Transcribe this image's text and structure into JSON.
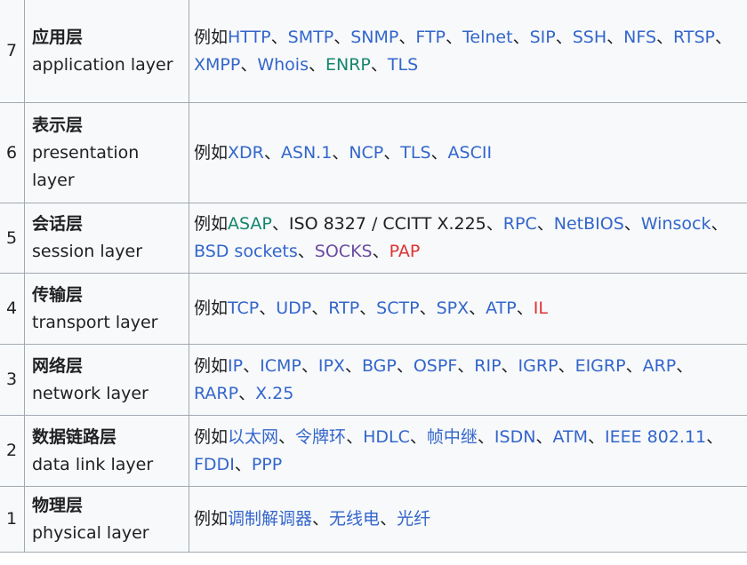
{
  "prefix": "例如",
  "rows": [
    {
      "num": "7",
      "name_zh": "应用层",
      "name_en": "application layer",
      "height": 116,
      "protocols": [
        {
          "text": "HTTP",
          "style": "link"
        },
        {
          "text": "SMTP",
          "style": "link"
        },
        {
          "text": "SNMP",
          "style": "link"
        },
        {
          "text": "FTP",
          "style": "link"
        },
        {
          "text": "Telnet",
          "style": "link"
        },
        {
          "text": "SIP",
          "style": "link"
        },
        {
          "text": "SSH",
          "style": "link"
        },
        {
          "text": "NFS",
          "style": "link"
        },
        {
          "text": "RTSP",
          "style": "link"
        },
        {
          "text": "XMPP",
          "style": "link"
        },
        {
          "text": "Whois",
          "style": "link"
        },
        {
          "text": "ENRP",
          "style": "green"
        },
        {
          "text": "TLS",
          "style": "link"
        }
      ]
    },
    {
      "num": "6",
      "name_zh": "表示层",
      "name_en": "presentation layer",
      "height": 113,
      "protocols": [
        {
          "text": "XDR",
          "style": "link"
        },
        {
          "text": "ASN.1",
          "style": "link"
        },
        {
          "text": "NCP",
          "style": "link"
        },
        {
          "text": "TLS",
          "style": "link"
        },
        {
          "text": "ASCII",
          "style": "link"
        }
      ]
    },
    {
      "num": "5",
      "name_zh": "会话层",
      "name_en": "session layer",
      "height": 79,
      "protocols": [
        {
          "text": "ASAP",
          "style": "green"
        },
        {
          "text": "ISO 8327 / CCITT X.225",
          "style": "plain"
        },
        {
          "text": "RPC",
          "style": "link"
        },
        {
          "text": "NetBIOS",
          "style": "link"
        },
        {
          "text": "Winsock",
          "style": "link"
        },
        {
          "text": "BSD sockets",
          "style": "link"
        },
        {
          "text": "SOCKS",
          "style": "purple"
        },
        {
          "text": "PAP",
          "style": "red"
        }
      ]
    },
    {
      "num": "4",
      "name_zh": "传输层",
      "name_en": "transport layer",
      "height": 80,
      "protocols": [
        {
          "text": "TCP",
          "style": "link"
        },
        {
          "text": "UDP",
          "style": "link"
        },
        {
          "text": "RTP",
          "style": "link"
        },
        {
          "text": "SCTP",
          "style": "link"
        },
        {
          "text": "SPX",
          "style": "link"
        },
        {
          "text": "ATP",
          "style": "link"
        },
        {
          "text": "IL",
          "style": "red"
        }
      ]
    },
    {
      "num": "3",
      "name_zh": "网络层",
      "name_en": "network layer",
      "height": 80,
      "protocols": [
        {
          "text": "IP",
          "style": "link"
        },
        {
          "text": "ICMP",
          "style": "link"
        },
        {
          "text": "IPX",
          "style": "link"
        },
        {
          "text": "BGP",
          "style": "link"
        },
        {
          "text": "OSPF",
          "style": "link"
        },
        {
          "text": "RIP",
          "style": "link"
        },
        {
          "text": "IGRP",
          "style": "link"
        },
        {
          "text": "EIGRP",
          "style": "link"
        },
        {
          "text": "ARP",
          "style": "link"
        },
        {
          "text": "RARP",
          "style": "link"
        },
        {
          "text": "X.25",
          "style": "link"
        }
      ]
    },
    {
      "num": "2",
      "name_zh": "数据链路层",
      "name_en": "data link layer",
      "height": 80,
      "protocols": [
        {
          "text": "以太网",
          "style": "link"
        },
        {
          "text": "令牌环",
          "style": "link"
        },
        {
          "text": "HDLC",
          "style": "link"
        },
        {
          "text": "帧中继",
          "style": "link"
        },
        {
          "text": "ISDN",
          "style": "link"
        },
        {
          "text": "ATM",
          "style": "link"
        },
        {
          "text": "IEEE 802.11",
          "style": "link"
        },
        {
          "text": "FDDI",
          "style": "link"
        },
        {
          "text": "PPP",
          "style": "link"
        }
      ]
    },
    {
      "num": "1",
      "name_zh": "物理层",
      "name_en": "physical layer",
      "height": 74,
      "protocols": [
        {
          "text": "调制解调器",
          "style": "link"
        },
        {
          "text": "无线电",
          "style": "link"
        },
        {
          "text": "光纤",
          "style": "link"
        }
      ]
    }
  ]
}
